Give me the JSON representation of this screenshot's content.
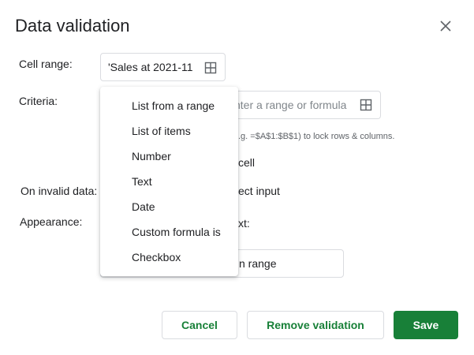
{
  "dialog": {
    "title": "Data validation"
  },
  "cell_range": {
    "label": "Cell range:",
    "value": "'Sales at 2021-11"
  },
  "criteria": {
    "label": "Criteria:",
    "range_placeholder_fragment": "nter a range or formula",
    "hint_fragment": ".g. =$A$1:$B$1) to lock rows & columns.",
    "show_dropdown_fragment": "cell"
  },
  "on_invalid": {
    "label": "On invalid data:",
    "option_fragment": "ect input"
  },
  "appearance": {
    "label": "Appearance:",
    "help_text_fragment": "xt:",
    "help_field_fragment": "n range"
  },
  "criteria_menu": {
    "items": [
      "List from a range",
      "List of items",
      "Number",
      "Text",
      "Date",
      "Custom formula is",
      "Checkbox"
    ]
  },
  "buttons": {
    "cancel": "Cancel",
    "remove": "Remove validation",
    "save": "Save"
  },
  "colors": {
    "accent": "#188038",
    "border": "#dadce0"
  }
}
